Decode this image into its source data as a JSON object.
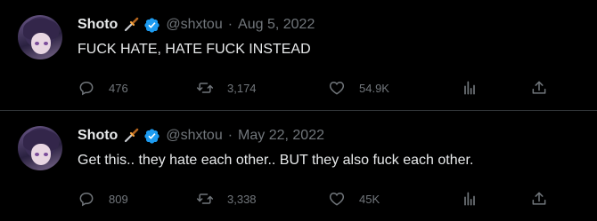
{
  "tweets": [
    {
      "author": "Shoto",
      "handle": "@shxtou",
      "separator": "·",
      "date": "Aug 5, 2022",
      "text": "FUCK HATE, HATE FUCK INSTEAD",
      "replies": "476",
      "retweets": "3,174",
      "likes": "54.9K"
    },
    {
      "author": "Shoto",
      "handle": "@shxtou",
      "separator": "·",
      "date": "May 22, 2022",
      "text": "Get this.. they hate each other.. BUT they also fuck each other.",
      "replies": "809",
      "retweets": "3,338",
      "likes": "45K"
    }
  ],
  "icons": {
    "name_emoji": "dagger-icon",
    "verified": "verified-badge-icon",
    "reply": "reply-icon",
    "retweet": "retweet-icon",
    "like": "heart-icon",
    "analytics": "analytics-icon",
    "share": "share-icon"
  },
  "colors": {
    "background": "#000000",
    "text": "#e7e9ea",
    "muted": "#71767b",
    "verified": "#1d9bf0",
    "divider": "#2f3336"
  }
}
